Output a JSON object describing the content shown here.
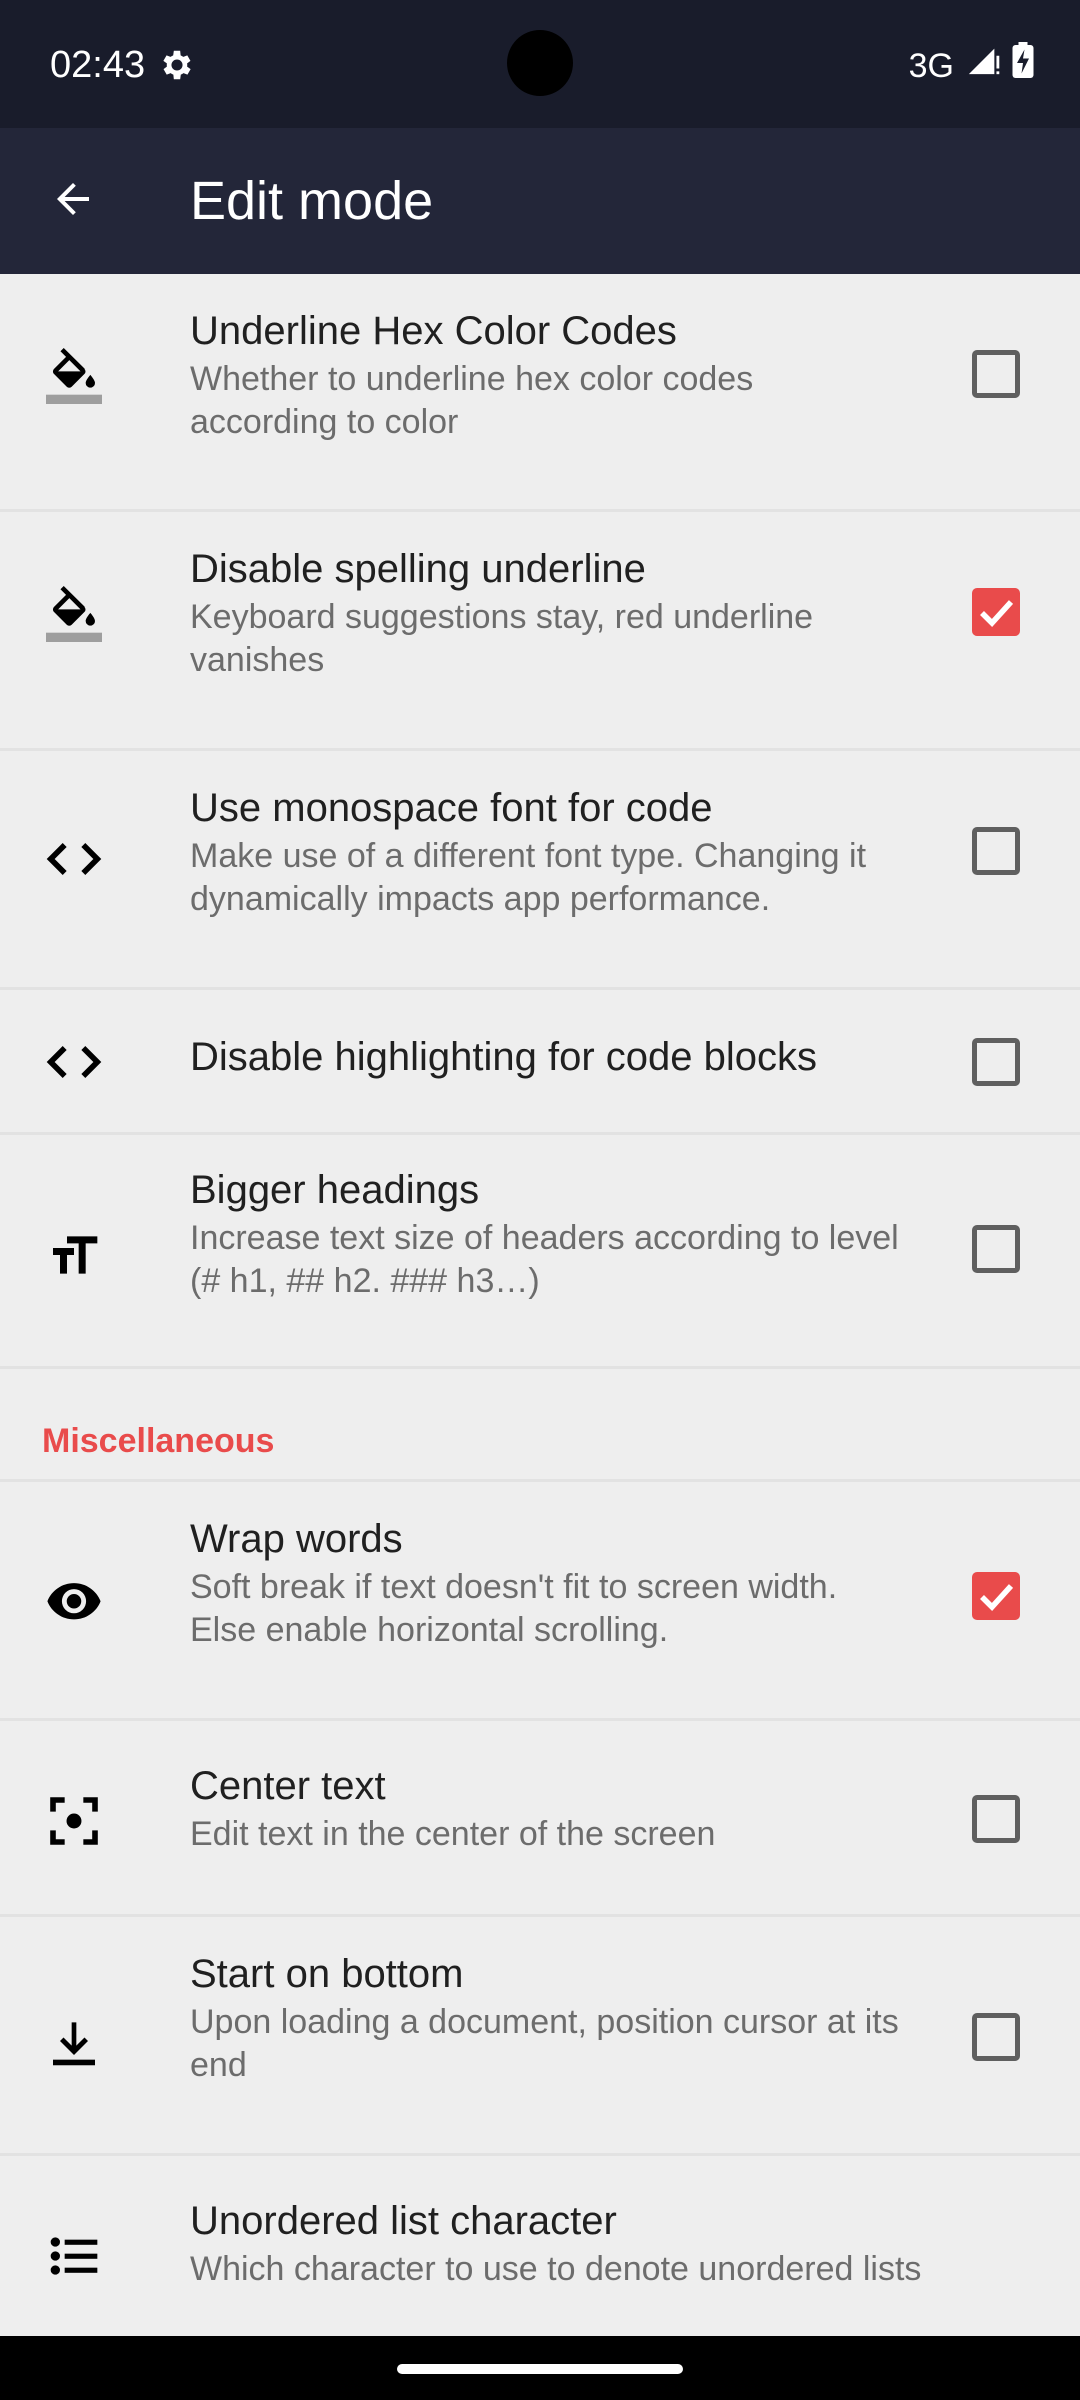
{
  "status_bar": {
    "time": "02:43",
    "network": "3G",
    "gear_icon": "gear-icon",
    "signal_icon": "signal-icon",
    "battery_icon": "battery-charging-icon"
  },
  "app_bar": {
    "title": "Edit mode",
    "back_icon": "arrow-back-icon"
  },
  "colors": {
    "status_bar_bg": "#191c2b",
    "app_bar_bg": "#232639",
    "accent": "#e94b4b",
    "list_bg": "#eeeeee"
  },
  "settings": [
    {
      "icon": "format-color-fill-icon",
      "title": "Underline Hex Color Codes",
      "summary": "Whether to underline hex color codes according to color",
      "checked": false
    },
    {
      "icon": "format-color-fill-icon",
      "title": "Disable spelling underline",
      "summary": "Keyboard suggestions stay, red underline vanishes",
      "checked": true
    },
    {
      "icon": "code-icon",
      "title": "Use monospace font for code",
      "summary": "Make use of a different font type. Changing it dynamically impacts app performance.",
      "checked": false
    },
    {
      "icon": "code-icon",
      "title": "Disable highlighting for code blocks",
      "summary": "",
      "checked": false
    },
    {
      "icon": "format-size-icon",
      "title": "Bigger headings",
      "summary": "Increase text size of headers according to level (# h1, ## h2. ### h3…)",
      "checked": false
    }
  ],
  "misc_section": {
    "title": "Miscellaneous"
  },
  "misc_settings": [
    {
      "icon": "eye-icon",
      "title": "Wrap words",
      "summary": "Soft break if text doesn't fit to screen width. Else enable horizontal scrolling.",
      "checked": true
    },
    {
      "icon": "center-focus-icon",
      "title": "Center text",
      "summary": "Edit text in the center of the screen",
      "checked": false
    },
    {
      "icon": "align-bottom-icon",
      "title": "Start on bottom",
      "summary": "Upon loading a document, position cursor at its end",
      "checked": false
    },
    {
      "icon": "bulleted-list-icon",
      "title": "Unordered list character",
      "summary": "Which character to use to denote unordered lists"
    }
  ]
}
